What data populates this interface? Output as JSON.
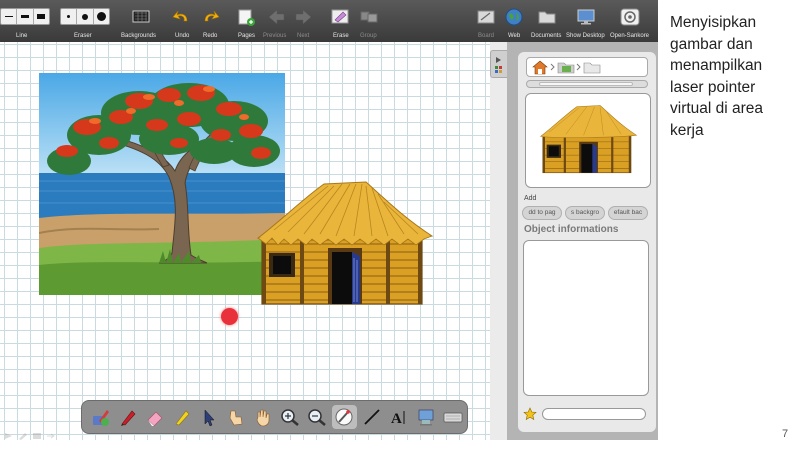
{
  "toolbar": {
    "line_label": "Line",
    "eraser_label": "Eraser",
    "backgrounds_label": "Backgrounds",
    "undo_label": "Undo",
    "redo_label": "Redo",
    "pages_label": "Pages",
    "previous_label": "Previous",
    "next_label": "Next",
    "erase_label": "Erase",
    "group_label": "Group",
    "board_label": "Board",
    "web_label": "Web",
    "documents_label": "Documents",
    "show_desktop_label": "Show Desktop",
    "open_sankore_label": "Open-Sankore"
  },
  "panel": {
    "add_label": "Add",
    "add_buttons": [
      "dd to pag",
      "s backgro",
      "efault bac"
    ],
    "object_info_title": "Object informations"
  },
  "caption": "Menyisipkan gambar dan menampilkan laser pointer virtual di area kerja",
  "page_number": "7",
  "colors": {
    "toolbar": "#444444",
    "laser": "#e8313a",
    "grid": "#c9dbe0",
    "panel": "#b4b4b4"
  },
  "palette_tools": [
    "stylus-icon",
    "pen-icon",
    "eraser-icon",
    "highlighter-icon",
    "selector-icon",
    "interact-icon",
    "hand-icon",
    "zoom-in-icon",
    "zoom-out-icon",
    "laser-pointer-icon",
    "line-icon",
    "text-icon",
    "capture-icon",
    "keyboard-icon"
  ]
}
